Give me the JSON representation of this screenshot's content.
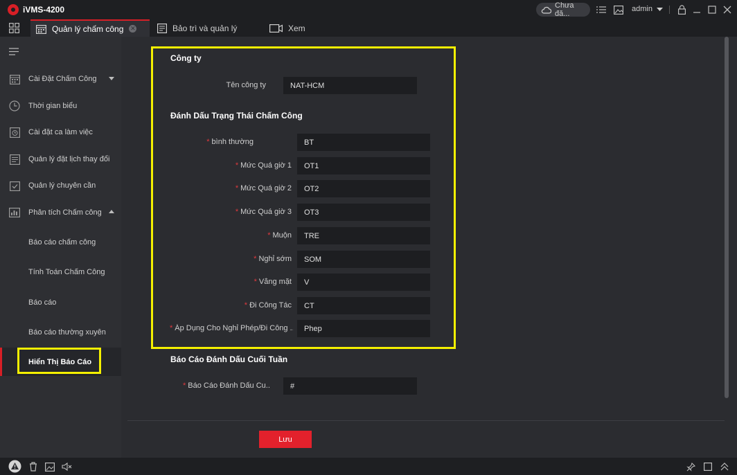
{
  "app": {
    "title": "iVMS-4200"
  },
  "titlebar": {
    "cloud_label": "Chưa đă...",
    "user": "admin"
  },
  "tabs": [
    {
      "label": "Quản lý chấm công",
      "icon": "calendar-icon",
      "active": true
    },
    {
      "label": "Bảo trì và quản lý",
      "icon": "maintenance-icon",
      "active": false
    },
    {
      "label": "Xem",
      "icon": "camera-icon",
      "active": false
    }
  ],
  "sidebar": {
    "items": [
      {
        "label": "Cài Đặt Chấm Công",
        "icon": "calendar-settings-icon"
      },
      {
        "label": "Thời gian biểu",
        "icon": "clock-icon"
      },
      {
        "label": "Cài đặt ca làm việc",
        "icon": "shift-icon"
      },
      {
        "label": "Quản lý đặt lịch thay đổi",
        "icon": "schedule-icon"
      },
      {
        "label": "Quản lý chuyên cần",
        "icon": "checklist-icon"
      },
      {
        "label": "Phân tích Chấm công",
        "icon": "analysis-icon"
      }
    ],
    "subitems": [
      {
        "label": "Báo cáo chấm công"
      },
      {
        "label": "Tính Toán Chấm Công"
      },
      {
        "label": "Báo cáo"
      },
      {
        "label": "Báo cáo thường xuyên"
      },
      {
        "label": "Hiển Thị Báo Cáo"
      }
    ]
  },
  "company": {
    "section_title": "Công ty",
    "name_label": "Tên công ty",
    "name_value": "NAT-HCM"
  },
  "status_marks": {
    "section_title": "Đánh Dấu Trạng Thái Chấm Công",
    "fields": [
      {
        "label": "bình thường",
        "value": "BT"
      },
      {
        "label": "Mức Quá giờ 1",
        "value": "OT1"
      },
      {
        "label": "Mức Quá giờ 2",
        "value": "OT2"
      },
      {
        "label": "Mức Quá giờ 3",
        "value": "OT3"
      },
      {
        "label": "Muộn",
        "value": "TRE"
      },
      {
        "label": "Nghỉ sớm",
        "value": "SOM"
      },
      {
        "label": "Vắng mặt",
        "value": "V"
      },
      {
        "label": "Đi Công Tác",
        "value": "CT"
      },
      {
        "label": "Áp Dụng Cho Nghỉ Phép/Đi Công ...",
        "value": "Phep"
      }
    ]
  },
  "weekend": {
    "section_title": "Báo Cáo Đánh Dấu Cuối Tuần",
    "label": "Báo Cáo Đánh Dấu Cu...",
    "value": "#"
  },
  "actions": {
    "save_label": "Lưu"
  },
  "colors": {
    "accent": "#d71f26",
    "highlight": "#f5f000",
    "background": "#2b2c30",
    "sidebar": "#2e2f33",
    "input": "#1d1e21"
  }
}
